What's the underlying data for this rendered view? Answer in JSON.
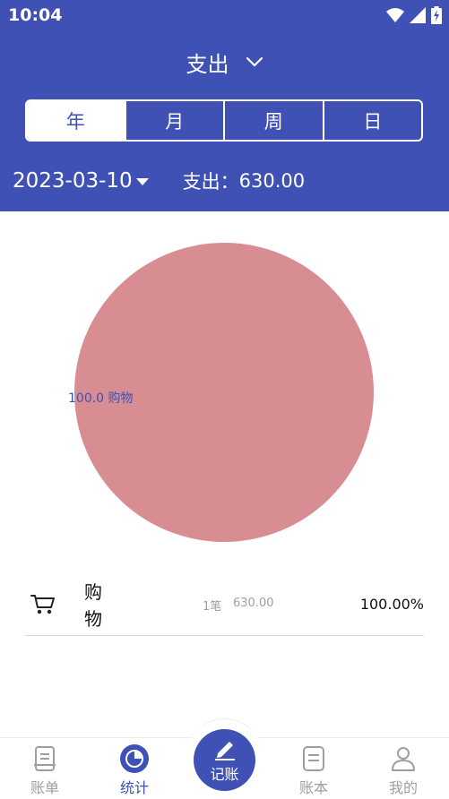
{
  "status_bar": {
    "time": "10:04",
    "icons": [
      "wifi-icon",
      "signal-icon",
      "battery-charging-icon"
    ]
  },
  "header": {
    "type_selector": "支出",
    "tabs": [
      {
        "label": "年",
        "active": true
      },
      {
        "label": "月",
        "active": false
      },
      {
        "label": "周",
        "active": false
      },
      {
        "label": "日",
        "active": false
      }
    ],
    "date": "2023-03-10",
    "total_label": "支出：",
    "total_value": "630.00"
  },
  "chart_data": {
    "type": "pie",
    "categories": [
      "购物"
    ],
    "values": [
      100.0
    ],
    "labels": [
      "100.0  购物"
    ],
    "colors": [
      "#d88d93"
    ]
  },
  "category_list": [
    {
      "icon": "shopping-cart-icon",
      "name": "购物",
      "count": "1笔",
      "amount": "630.00",
      "percent": "100.00%"
    }
  ],
  "bottom_nav": {
    "items": [
      {
        "label": "账单",
        "icon": "bill-icon",
        "active": false
      },
      {
        "label": "统计",
        "icon": "pie-chart-icon",
        "active": true
      },
      {
        "label": "记账",
        "icon": "pen-icon",
        "active": false,
        "center": true
      },
      {
        "label": "账本",
        "icon": "ledger-icon",
        "active": false
      },
      {
        "label": "我的",
        "icon": "person-icon",
        "active": false
      }
    ]
  },
  "colors": {
    "primary": "#3f51b5",
    "slice": "#d88d93",
    "muted_text": "#9e9e9e"
  }
}
